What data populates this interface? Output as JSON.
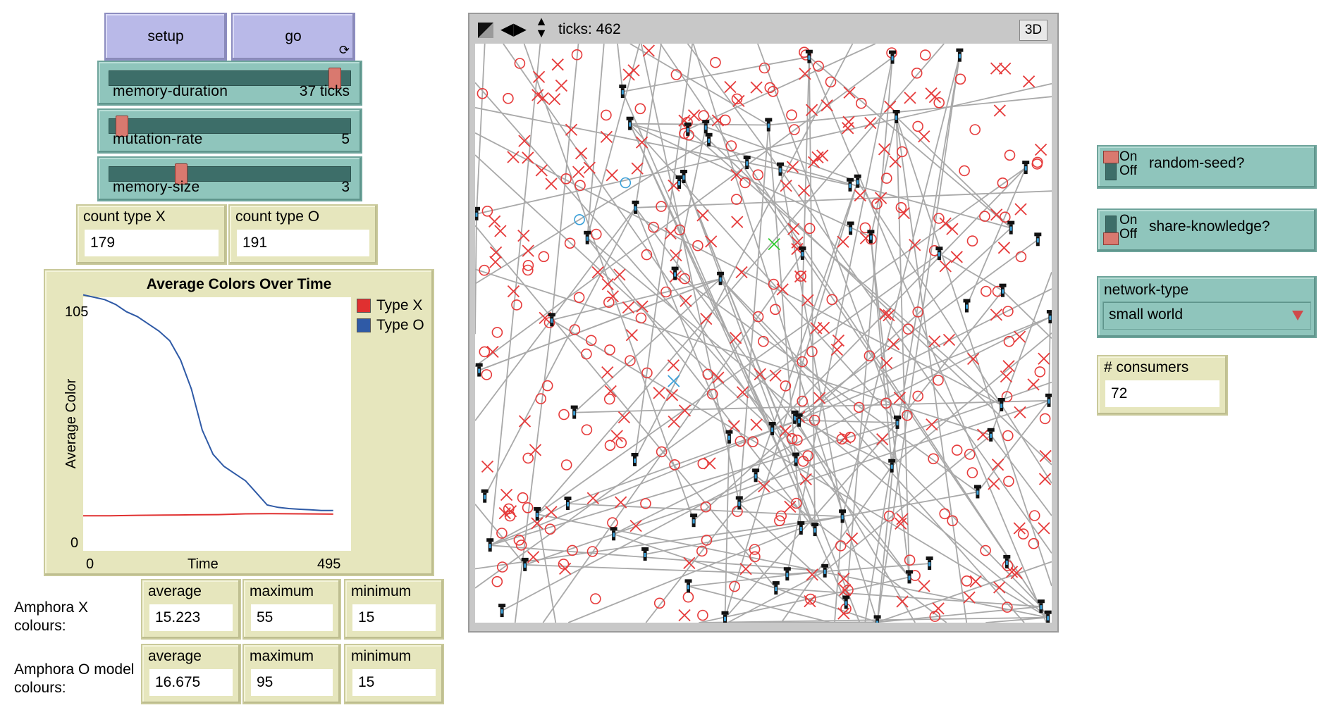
{
  "buttons": {
    "setup": "setup",
    "go": "go",
    "go_forever_icon": "⟳"
  },
  "sliders": [
    {
      "label": "memory-duration",
      "value_text": "37 ticks",
      "fraction": 0.9
    },
    {
      "label": "mutation-rate",
      "value_text": "5",
      "fraction": 0.04
    },
    {
      "label": "memory-size",
      "value_text": "3",
      "fraction": 0.28
    }
  ],
  "monitors": {
    "count_x": {
      "label": "count type X",
      "value": "179"
    },
    "count_o": {
      "label": "count type O",
      "value": "191"
    },
    "x_average": {
      "label": "average",
      "value": "15.223"
    },
    "x_maximum": {
      "label": "maximum",
      "value": "55"
    },
    "x_minimum": {
      "label": "minimum",
      "value": "15"
    },
    "o_average": {
      "label": "average",
      "value": "16.675"
    },
    "o_maximum": {
      "label": "maximum",
      "value": "95"
    },
    "o_minimum": {
      "label": "minimum",
      "value": "15"
    }
  },
  "notes": {
    "amphora_x": "Amphora X colours:",
    "amphora_o": "Amphora O model colours:"
  },
  "chart_data": {
    "type": "line",
    "title": "Average Colors Over Time",
    "xlabel": "Time",
    "ylabel": "Average Color",
    "xlim": [
      0,
      495
    ],
    "ylim": [
      0,
      105
    ],
    "x_min_label": "0",
    "x_max_label": "495",
    "y_min_label": "0",
    "y_max_label": "105",
    "legend_position": "top-right",
    "series": [
      {
        "name": "Type X",
        "color": "#e03030",
        "x": [
          0,
          50,
          100,
          150,
          200,
          250,
          300,
          350,
          400,
          462
        ],
        "y": [
          14.5,
          14.5,
          14.7,
          14.8,
          14.9,
          15.0,
          15.3,
          15.4,
          15.3,
          15.2
        ]
      },
      {
        "name": "Type O",
        "color": "#2f5aa6",
        "x": [
          0,
          20,
          40,
          60,
          80,
          100,
          120,
          140,
          160,
          180,
          200,
          220,
          240,
          260,
          280,
          300,
          320,
          340,
          360,
          380,
          400,
          420,
          440,
          462
        ],
        "y": [
          106,
          105,
          104,
          102,
          99,
          97,
          94,
          91,
          87,
          79,
          67,
          50,
          40,
          35,
          32,
          29,
          24,
          19,
          18,
          17.5,
          17.2,
          17,
          16.7,
          16.7
        ]
      }
    ]
  },
  "switches": [
    {
      "label": "random-seed?",
      "on_text": "On",
      "off_text": "Off",
      "state": "on"
    },
    {
      "label": "share-knowledge?",
      "on_text": "On",
      "off_text": "Off",
      "state": "off"
    }
  ],
  "chooser": {
    "label": "network-type",
    "value": "small world"
  },
  "consumers": {
    "label": "# consumers",
    "value": "72"
  },
  "view": {
    "ticks": "ticks: 462",
    "three_d": "3D",
    "colors": {
      "link": "#a9a9a9",
      "agent_x": "#e63b3b",
      "agent_o": "#e63b3b",
      "consumer": "#111111",
      "odd_blue": "#3ca0d8",
      "odd_green": "#33cc33"
    }
  }
}
